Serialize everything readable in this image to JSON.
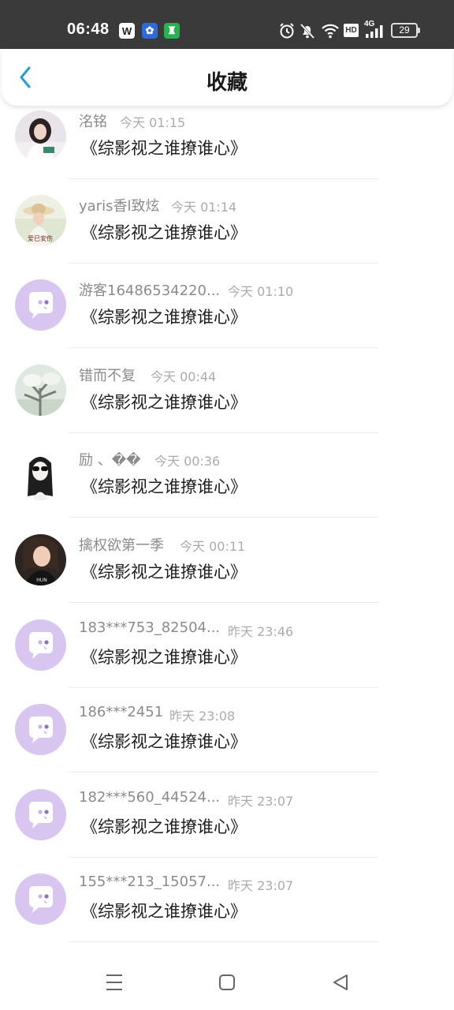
{
  "status_bar": {
    "time": "06:48",
    "app_badges": [
      "W",
      "✿",
      "♜"
    ],
    "battery": "29",
    "network": "4G",
    "hd": "HD"
  },
  "header": {
    "title": "收藏",
    "back_icon": "chevron-left-icon"
  },
  "colors": {
    "accent": "#2b9bd8",
    "default_avatar": "#d8c6f1"
  },
  "favorites": [
    {
      "user": "洺铭",
      "time": "今天 01:15",
      "title": "《综影视之谁撩谁心》",
      "avatar": "photo-girl-white"
    },
    {
      "user": "yaris香l致炫",
      "time": "今天 01:14",
      "title": "《综影视之谁撩谁心》",
      "avatar": "photo-girl-hat"
    },
    {
      "user": "游客16486534220...",
      "time": "今天 01:10",
      "title": "《综影视之谁撩谁心》",
      "avatar": "default-chat-avatar"
    },
    {
      "user": "错而不复",
      "time": "今天 00:44",
      "title": "《综影视之谁撩谁心》",
      "avatar": "photo-tree"
    },
    {
      "user": "励 、��",
      "time": "今天 00:36",
      "title": "《综影视之谁撩谁心》",
      "avatar": "drawing-girl-sunglasses"
    },
    {
      "user": "擒权欲第一季",
      "time": "今天 00:11",
      "title": "《综影视之谁撩谁心》",
      "avatar": "photo-girl-black"
    },
    {
      "user": "183***753_82504...",
      "time": "昨天 23:46",
      "title": "《综影视之谁撩谁心》",
      "avatar": "default-chat-avatar"
    },
    {
      "user": "186***2451",
      "time": "昨天 23:08",
      "title": "《综影视之谁撩谁心》",
      "avatar": "default-chat-avatar"
    },
    {
      "user": "182***560_44524...",
      "time": "昨天 23:07",
      "title": "《综影视之谁撩谁心》",
      "avatar": "default-chat-avatar"
    },
    {
      "user": "155***213_15057...",
      "time": "昨天 23:07",
      "title": "《综影视之谁撩谁心》",
      "avatar": "default-chat-avatar"
    }
  ],
  "nav": [
    "menu-icon",
    "home-square-icon",
    "back-triangle-icon"
  ]
}
